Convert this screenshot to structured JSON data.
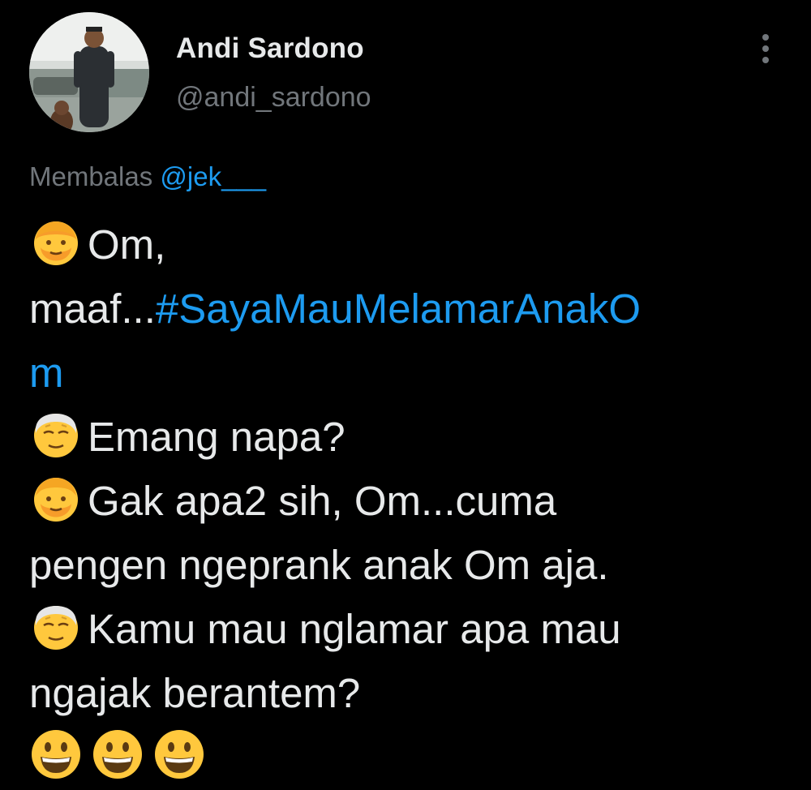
{
  "user": {
    "display_name": "Andi Sardono",
    "handle": "@andi_sardono"
  },
  "reply": {
    "prefix": "Membalas",
    "mention": "@jek___"
  },
  "body": {
    "line1": "Om,",
    "line2_text": "maaf...",
    "hashtag_part1": "#SayaMauMelamarAnakO",
    "hashtag_part2": "m",
    "line4": "Emang napa?",
    "line5": "Gak apa2 sih, Om...cuma",
    "line6": "pengen ngeprank anak Om aja.",
    "line7": "Kamu mau nglamar apa mau",
    "line8": "ngajak berantem?"
  },
  "icons": {
    "speaker_young": "person-blond-beard-emoji",
    "speaker_old": "older-man-emoji",
    "ending": "grinning-face-emoji",
    "menu": "more-options-icon"
  },
  "colors": {
    "background": "#000000",
    "text": "#e7e9ea",
    "secondary": "#71767b",
    "link": "#1d9bf0"
  }
}
